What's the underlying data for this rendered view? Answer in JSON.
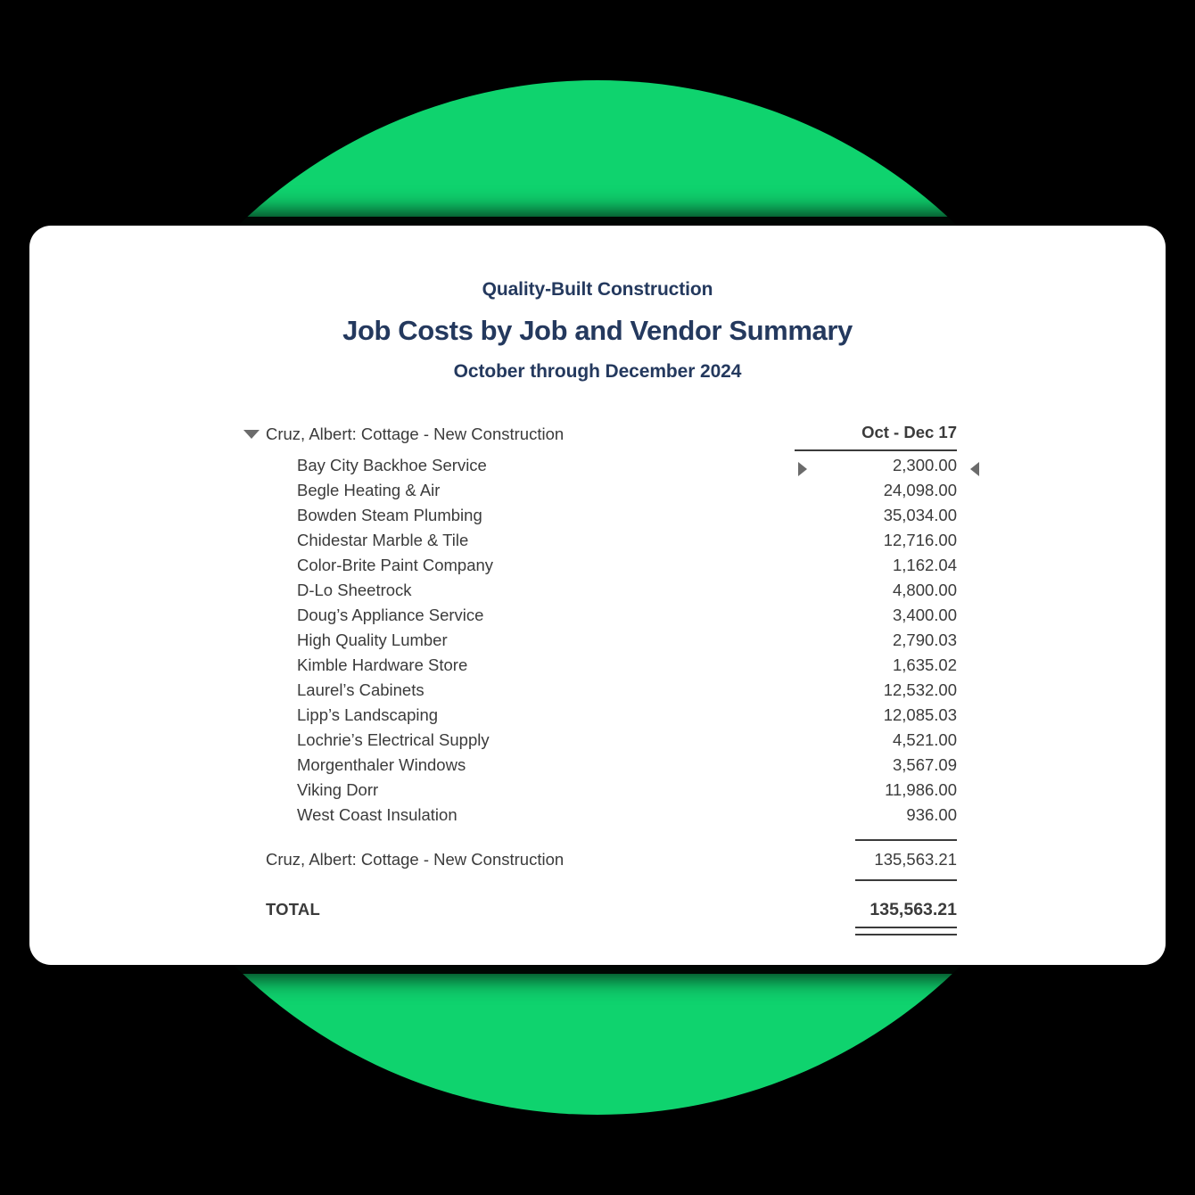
{
  "theme": {
    "background": "#000000",
    "accent_circle": "#0FD36E",
    "card_background": "#FFFFFF",
    "heading_color": "#24395E",
    "body_text_color": "#3B3B3B",
    "marker_color": "#6B6B6B"
  },
  "report": {
    "company": "Quality-Built Construction",
    "title": "Job Costs by Job and Vendor Summary",
    "period": "October through December 2024",
    "column_header": "Oct - Dec 17",
    "section": {
      "name": "Cruz, Albert: Cottage - New Construction",
      "collapse_icon": "triangle-down-icon",
      "expanded": true
    },
    "rows": [
      {
        "vendor": "Bay City Backhoe Service",
        "amount": "2,300.00"
      },
      {
        "vendor": "Begle Heating & Air",
        "amount": "24,098.00"
      },
      {
        "vendor": "Bowden Steam Plumbing",
        "amount": "35,034.00"
      },
      {
        "vendor": "Chidestar Marble & Tile",
        "amount": "12,716.00"
      },
      {
        "vendor": "Color-Brite Paint Company",
        "amount": "1,162.04"
      },
      {
        "vendor": "D-Lo Sheetrock",
        "amount": "4,800.00"
      },
      {
        "vendor": "Doug’s Appliance Service",
        "amount": "3,400.00"
      },
      {
        "vendor": "High Quality Lumber",
        "amount": "2,790.03"
      },
      {
        "vendor": "Kimble Hardware Store",
        "amount": "1,635.02"
      },
      {
        "vendor": "Laurel’s Cabinets",
        "amount": "12,532.00"
      },
      {
        "vendor": "Lipp’s Landscaping",
        "amount": "12,085.03"
      },
      {
        "vendor": "Lochrie’s Electrical Supply",
        "amount": "4,521.00"
      },
      {
        "vendor": "Morgenthaler Windows",
        "amount": "3,567.09"
      },
      {
        "vendor": "Viking Dorr",
        "amount": "11,986.00"
      },
      {
        "vendor": "West Coast Insulation",
        "amount": "936.00"
      }
    ],
    "subtotal": {
      "label": "Cruz, Albert: Cottage - New Construction",
      "amount": "135,563.21"
    },
    "total": {
      "label": "TOTAL",
      "amount": "135,563.21"
    },
    "markers": {
      "drill_right_icon": "triangle-right-icon",
      "drill_left_icon": "triangle-left-icon"
    }
  }
}
